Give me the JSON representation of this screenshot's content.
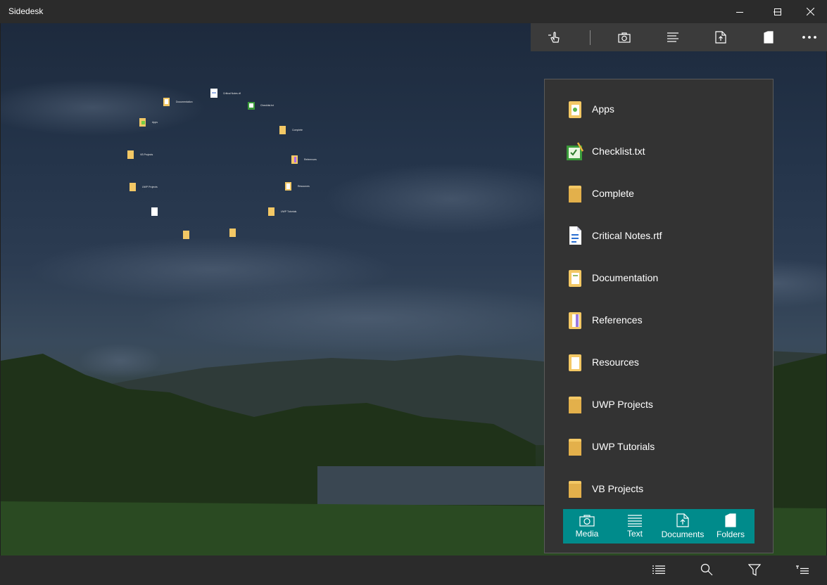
{
  "window": {
    "title": "Sidedesk"
  },
  "toolbar": {
    "buttons": [
      "touch-mode",
      "camera",
      "text",
      "document",
      "folder",
      "more"
    ]
  },
  "panel": {
    "items": [
      {
        "name": "Apps",
        "icon": "folder-app-icon"
      },
      {
        "name": "Checklist.txt",
        "icon": "checklist-icon"
      },
      {
        "name": "Complete",
        "icon": "folder-icon"
      },
      {
        "name": "Critical Notes.rtf",
        "icon": "rtf-document-icon"
      },
      {
        "name": "Documentation",
        "icon": "folder-icon"
      },
      {
        "name": "References",
        "icon": "folder-icon"
      },
      {
        "name": "Resources",
        "icon": "folder-icon"
      },
      {
        "name": "UWP Projects",
        "icon": "folder-icon"
      },
      {
        "name": "UWP Tutorials",
        "icon": "folder-icon"
      },
      {
        "name": "VB Projects",
        "icon": "folder-icon"
      }
    ],
    "tabs": [
      {
        "label": "Media",
        "icon": "camera-icon"
      },
      {
        "label": "Text",
        "icon": "text-lines-icon"
      },
      {
        "label": "Documents",
        "icon": "document-icon"
      },
      {
        "label": "Folders",
        "icon": "folder-icon"
      }
    ]
  },
  "bottombar": {
    "buttons": [
      "list-view",
      "search",
      "filter",
      "sort"
    ]
  },
  "colors": {
    "accent": "#008b8b",
    "panel": "#333333",
    "bar": "#2b2b2b",
    "folder": "#f3c865"
  }
}
